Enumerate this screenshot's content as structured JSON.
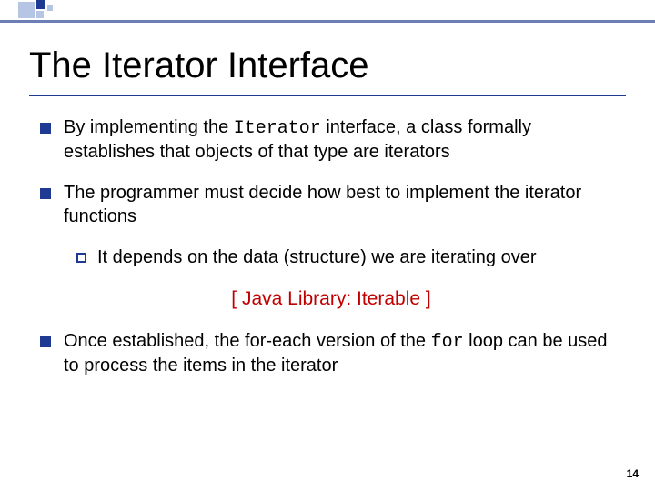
{
  "title": "The Iterator Interface",
  "bullets": {
    "b1": {
      "pre": "By implementing the ",
      "code": "Iterator",
      "post": " interface, a class formally establishes that objects of that type are iterators"
    },
    "b2": "The programmer must decide how best to implement the iterator functions",
    "b2sub": "It depends on the data (structure) we are iterating over",
    "link": "[ Java Library: Iterable ]",
    "b3": {
      "pre": "Once established, the for-each version of the ",
      "code": "for",
      "post": " loop can be used to process the items in the iterator"
    }
  },
  "page": "14"
}
